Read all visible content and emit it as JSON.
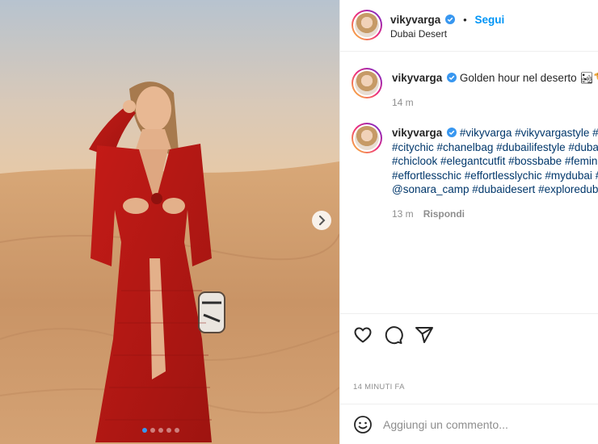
{
  "post": {
    "username": "vikyvarga",
    "follow_label": "Segui",
    "separator": "•",
    "location": "Dubai Desert",
    "next_icon": "chevron-right-icon",
    "carousel": {
      "count": 5,
      "active": 0
    }
  },
  "caption": {
    "username": "vikyvarga",
    "text": "Golden hour nel deserto 🏜🐪",
    "time": "14 m"
  },
  "comment": {
    "username": "vikyvarga",
    "lines": [
      "#vikyvarga #vikyvargastyle #st",
      "#citychic #chanelbag #dubailifestyle #duba",
      "#chiclook #elegantcutfit #bossbabe #femin",
      "#effortlesschic #effortlesslychic #mydubai #",
      "@sonara_camp #dubaidesert #exploreduba"
    ],
    "time": "13 m",
    "reply_label": "Rispondi"
  },
  "actions": {
    "icons": [
      "heart-icon",
      "comment-icon",
      "share-icon"
    ]
  },
  "timeago": "14 MINUTI FA",
  "add_comment": {
    "placeholder": "Aggiungi un commento..."
  },
  "colors": {
    "link": "#0095f6",
    "hashtag": "#00376b",
    "muted": "#8e8e8e",
    "verified": "#3897f0"
  }
}
